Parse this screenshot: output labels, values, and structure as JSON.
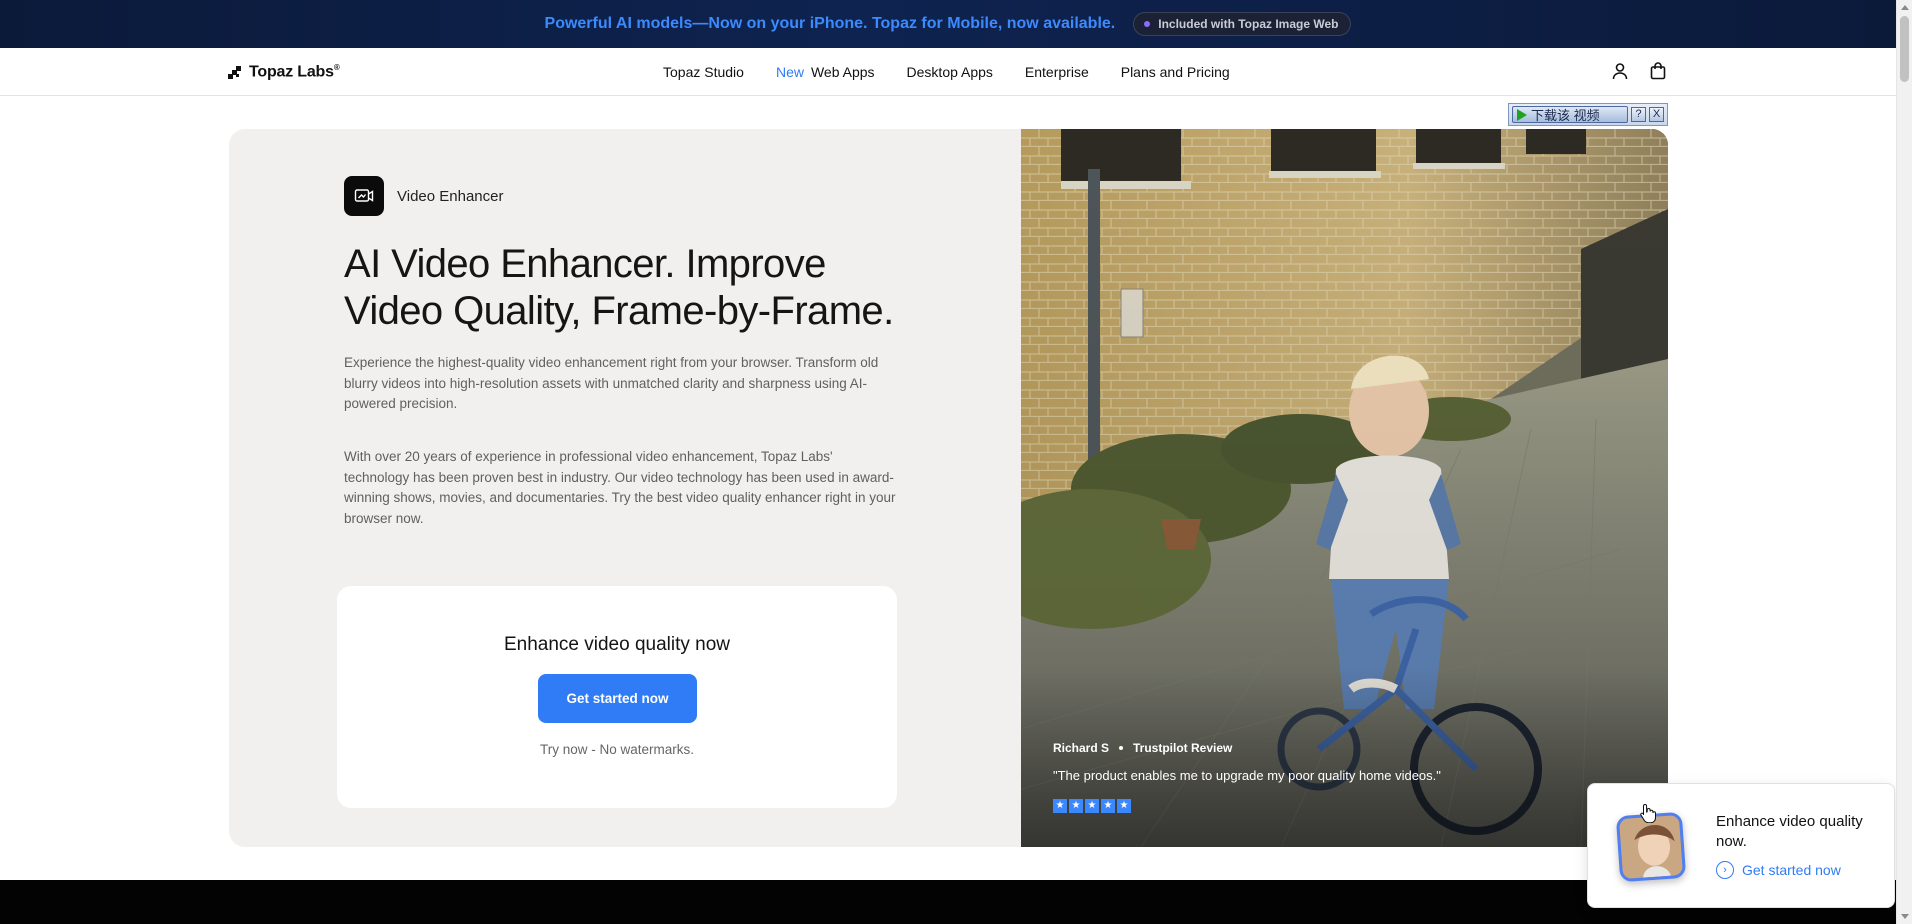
{
  "announcement": {
    "text": "Powerful AI models—Now on your iPhone. Topaz for Mobile, now available.",
    "badge": "Included with Topaz Image Web"
  },
  "nav": {
    "logo": "Topaz Labs",
    "logo_mark": "®",
    "links": [
      "Topaz Studio",
      "Web Apps",
      "Desktop Apps",
      "Enterprise",
      "Plans and Pricing"
    ],
    "new_tag": "New",
    "icons": [
      "user-icon",
      "shopping-bag-icon"
    ]
  },
  "download_overlay": {
    "label": "下载该 视频",
    "help": "?",
    "close": "X"
  },
  "hero": {
    "product_label": "Video Enhancer",
    "headline_line1": "AI Video Enhancer. Improve",
    "headline_line2": "Video Quality, Frame-by-Frame.",
    "paragraph1": "Experience the highest-quality video enhancement right from your browser. Transform old blurry videos into high-resolution assets with unmatched clarity and sharpness using AI-powered precision.",
    "paragraph2": "With over 20 years of experience in professional video enhancement, Topaz Labs' technology has been proven best in industry. Our video technology has been used in award-winning shows, movies, and documentaries. Try the best video quality enhancer right in your browser now.",
    "cta": {
      "title": "Enhance video quality now",
      "button": "Get started now",
      "note": "Try now - No watermarks."
    },
    "review": {
      "author": "Richard S",
      "source": "Trustpilot Review",
      "quote": "\"The product enables me to upgrade my poor quality home videos.\"",
      "stars": 5
    }
  },
  "popup": {
    "title": "Enhance video quality now.",
    "link": "Get started now"
  },
  "colors": {
    "accent": "#2f7cf6",
    "announcement_bg": "#0c1a3a",
    "hero_bg": "#f1f0ee"
  }
}
